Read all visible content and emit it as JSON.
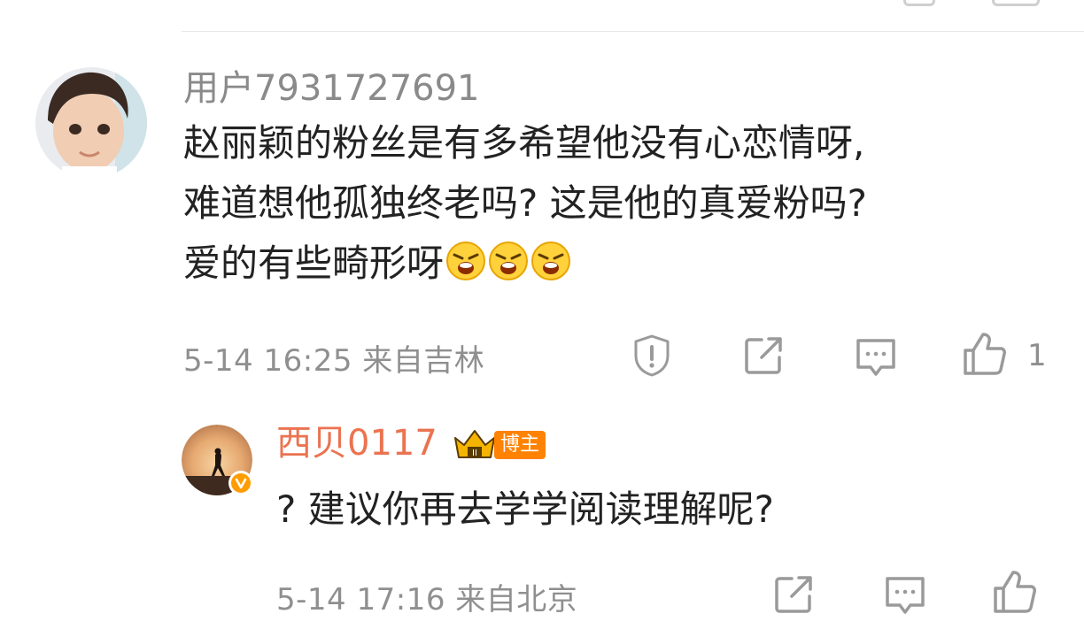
{
  "comment": {
    "username": "用户7931727691",
    "text_lines": [
      "赵丽颖的粉丝是有多希望他没有心恋情呀,",
      "难道想他孤独终老吗? 这是他的真爱粉吗?",
      "爱的有些畸形呀"
    ],
    "emojis": [
      "angry-emoji",
      "angry-emoji",
      "angry-emoji"
    ],
    "meta": "5-14 16:25 来自吉林",
    "like_count": "1"
  },
  "reply": {
    "username": "西贝0117",
    "badge_label": "博主",
    "text": "? 建议你再去学学阅读理解呢?",
    "meta": "5-14 17:16 来自北京"
  },
  "colors": {
    "username_gray": "#8a8a8a",
    "username_orange": "#eb7350",
    "meta_gray": "#8f8f8f",
    "icon_gray": "#9a9a9a",
    "badge_orange": "#ff8200"
  }
}
